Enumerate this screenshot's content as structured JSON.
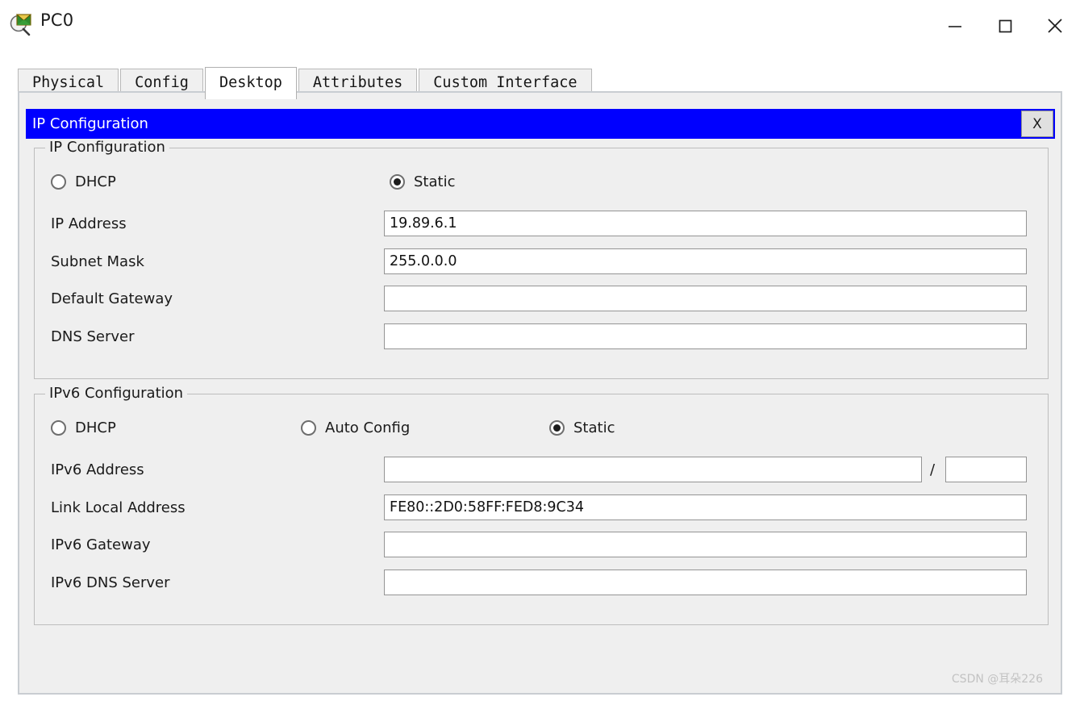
{
  "window": {
    "title": "PC0",
    "icon": "inspect-magnifier-icon",
    "controls": {
      "minimize": "minimize-icon",
      "maximize": "maximize-icon",
      "close": "close-icon"
    }
  },
  "tabs": [
    {
      "label": "Physical",
      "active": false
    },
    {
      "label": "Config",
      "active": false
    },
    {
      "label": "Desktop",
      "active": true
    },
    {
      "label": "Attributes",
      "active": false
    },
    {
      "label": "Custom Interface",
      "active": false
    }
  ],
  "dialog": {
    "title": "IP Configuration",
    "close_label": "X",
    "accent_color": "#0000FF"
  },
  "ipv4": {
    "legend": "IP Configuration",
    "mode_options": [
      {
        "label": "DHCP",
        "selected": false
      },
      {
        "label": "Static",
        "selected": true
      }
    ],
    "fields": [
      {
        "label": "IP Address",
        "value": "19.89.6.1",
        "placeholder": ""
      },
      {
        "label": "Subnet Mask",
        "value": "255.0.0.0",
        "placeholder": ""
      },
      {
        "label": "Default Gateway",
        "value": "",
        "placeholder": ""
      },
      {
        "label": "DNS Server",
        "value": "",
        "placeholder": ""
      }
    ]
  },
  "ipv6": {
    "legend": "IPv6 Configuration",
    "mode_options": [
      {
        "label": "DHCP",
        "selected": false
      },
      {
        "label": "Auto Config",
        "selected": false
      },
      {
        "label": "Static",
        "selected": true
      }
    ],
    "address_row": {
      "label": "IPv6 Address",
      "value": "",
      "separator": "/",
      "prefix_value": ""
    },
    "fields": [
      {
        "label": "Link Local Address",
        "value": "FE80::2D0:58FF:FED8:9C34",
        "placeholder": ""
      },
      {
        "label": "IPv6 Gateway",
        "value": "",
        "placeholder": ""
      },
      {
        "label": "IPv6 DNS Server",
        "value": "",
        "placeholder": ""
      }
    ]
  },
  "watermark": "CSDN @耳朵226"
}
